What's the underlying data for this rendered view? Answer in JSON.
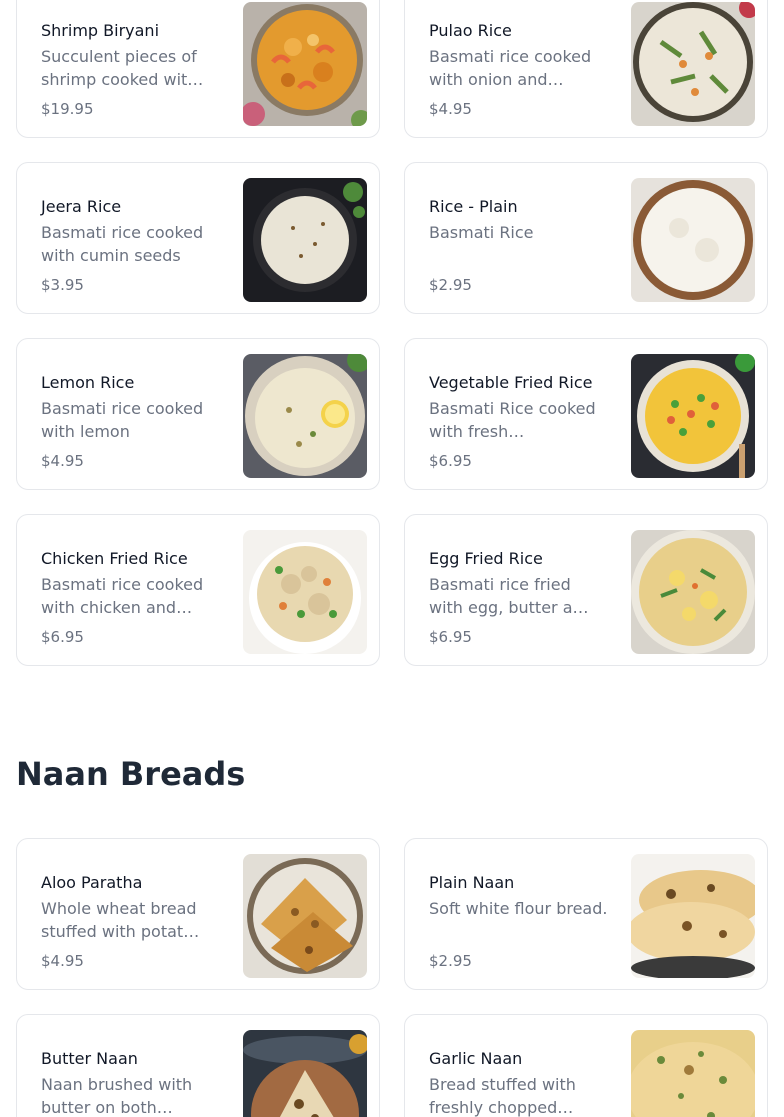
{
  "sections": [
    {
      "title": "",
      "items": [
        {
          "name": "Shrimp Biryani",
          "description": "Succulent pieces of shrimp cooked wit…",
          "price": "$19.95",
          "image": "shrimp-biryani-image"
        },
        {
          "name": "Pulao Rice",
          "description": "Basmati rice cooked with onion and…",
          "price": "$4.95",
          "image": "pulao-rice-image"
        },
        {
          "name": "Jeera Rice",
          "description": "Basmati rice cooked with cumin seeds",
          "price": "$3.95",
          "image": "jeera-rice-image"
        },
        {
          "name": "Rice - Plain",
          "description": "Basmati Rice",
          "price": "$2.95",
          "image": "plain-rice-image"
        },
        {
          "name": "Lemon Rice",
          "description": "Basmati rice cooked with lemon",
          "price": "$4.95",
          "image": "lemon-rice-image"
        },
        {
          "name": "Vegetable Fried Rice",
          "description": "Basmati Rice cooked with fresh…",
          "price": "$6.95",
          "image": "vegetable-fried-rice-image"
        },
        {
          "name": "Chicken Fried Rice",
          "description": "Basmati rice cooked with chicken and…",
          "price": "$6.95",
          "image": "chicken-fried-rice-image"
        },
        {
          "name": "Egg Fried Rice",
          "description": "Basmati rice fried with egg, butter a…",
          "price": "$6.95",
          "image": "egg-fried-rice-image"
        }
      ]
    },
    {
      "title": "Naan Breads",
      "items": [
        {
          "name": "Aloo Paratha",
          "description": "Whole wheat bread stuffed with potat…",
          "price": "$4.95",
          "image": "aloo-paratha-image"
        },
        {
          "name": "Plain Naan",
          "description": "Soft white flour bread.",
          "price": "$2.95",
          "image": "plain-naan-image"
        },
        {
          "name": "Butter Naan",
          "description": "Naan brushed with butter on both…",
          "price": "",
          "image": "butter-naan-image"
        },
        {
          "name": "Garlic Naan",
          "description": "Bread stuffed with freshly chopped…",
          "price": "",
          "image": "garlic-naan-image"
        }
      ]
    }
  ]
}
